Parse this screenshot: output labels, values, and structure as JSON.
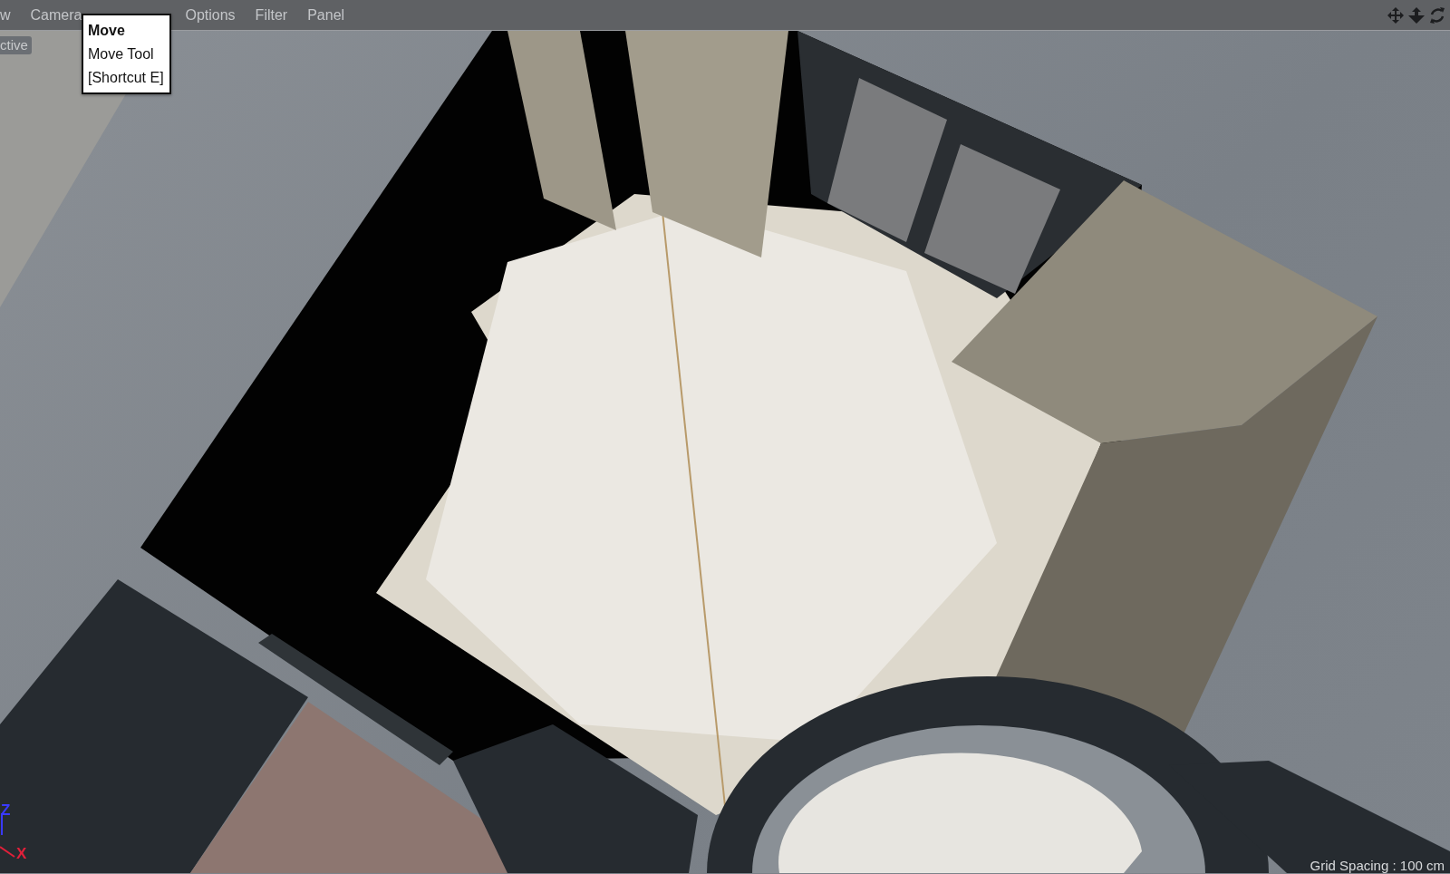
{
  "menu_bar": {
    "items": [
      "w",
      "Camera",
      "Options",
      "Filter",
      "Panel"
    ]
  },
  "viewport": {
    "projection_label": "ctive",
    "axis_labels": [
      {
        "kind": "z",
        "text": "Z"
      },
      {
        "kind": "x",
        "text": "X"
      }
    ],
    "grid_spacing": "Grid Spacing : 100 cm"
  },
  "tooltip": {
    "title": "Move",
    "name": "Move Tool",
    "shortcut": "[Shortcut E]"
  }
}
